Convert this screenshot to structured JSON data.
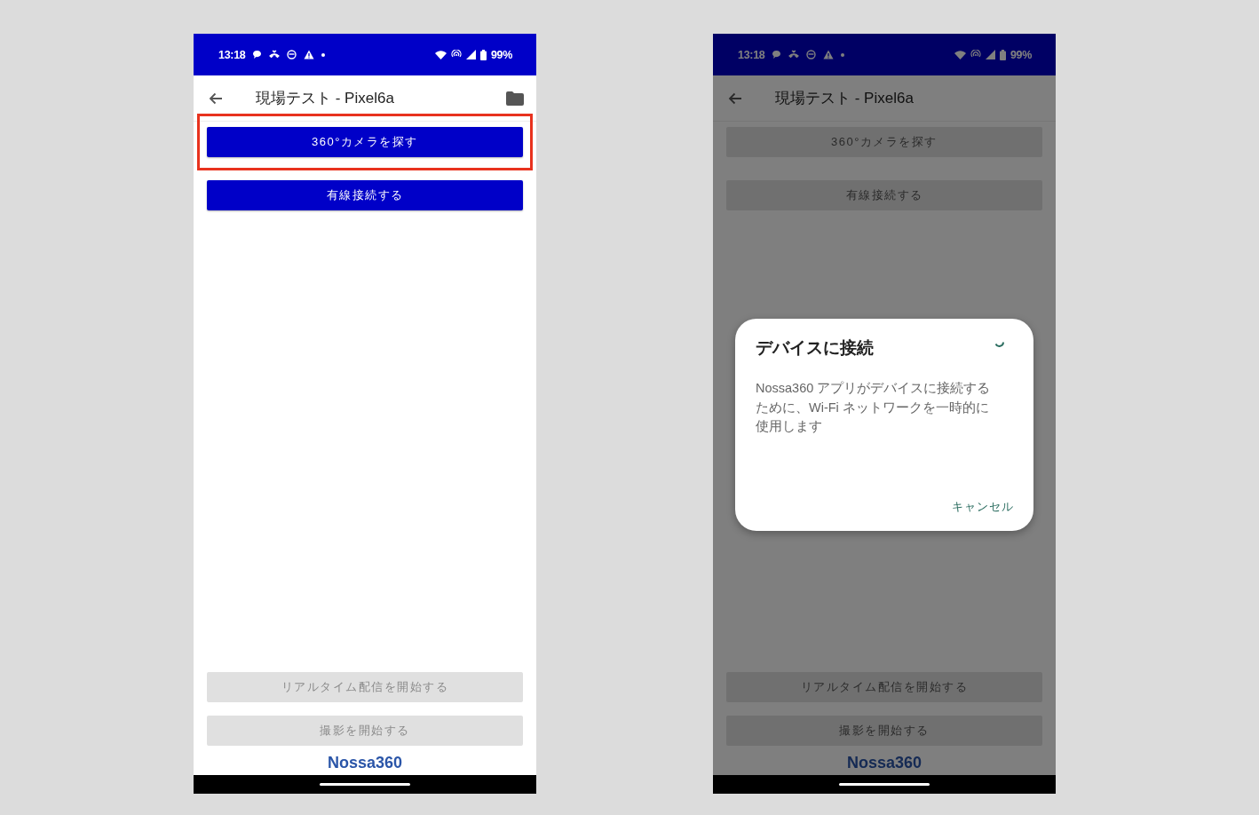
{
  "phones": [
    {
      "dimmed": false,
      "status_bar": {
        "time": "13:18",
        "battery": "99%"
      },
      "app_bar": {
        "title": "現場テスト - Pixel6a",
        "folder_button": true
      },
      "top_buttons": [
        {
          "label": "360°カメラを探す",
          "disabled": false,
          "highlighted": true
        },
        {
          "label": "有線接続する",
          "disabled": false,
          "highlighted": false
        }
      ],
      "bottom_buttons": [
        {
          "label": "リアルタイム配信を開始する",
          "disabled": true,
          "highlighted": false
        },
        {
          "label": "撮影を開始する",
          "disabled": true,
          "highlighted": false
        }
      ],
      "logo": "Nossa360"
    },
    {
      "dimmed": true,
      "status_bar": {
        "time": "13:18",
        "battery": "99%"
      },
      "app_bar": {
        "title": "現場テスト - Pixel6a",
        "folder_button": false
      },
      "top_buttons": [
        {
          "label": "360°カメラを探す",
          "disabled": true,
          "highlighted": false
        },
        {
          "label": "有線接続する",
          "disabled": true,
          "highlighted": false
        }
      ],
      "bottom_buttons": [
        {
          "label": "リアルタイム配信を開始する",
          "disabled": true,
          "highlighted": false
        },
        {
          "label": "撮影を開始する",
          "disabled": true,
          "highlighted": false
        }
      ],
      "logo": "Nossa360",
      "dialog": {
        "title": "デバイスに接続",
        "message": "Nossa360 アプリがデバイスに接続するために、Wi-Fi ネットワークを一時的に使用します",
        "action": "キャンセル",
        "loading": true
      }
    }
  ]
}
